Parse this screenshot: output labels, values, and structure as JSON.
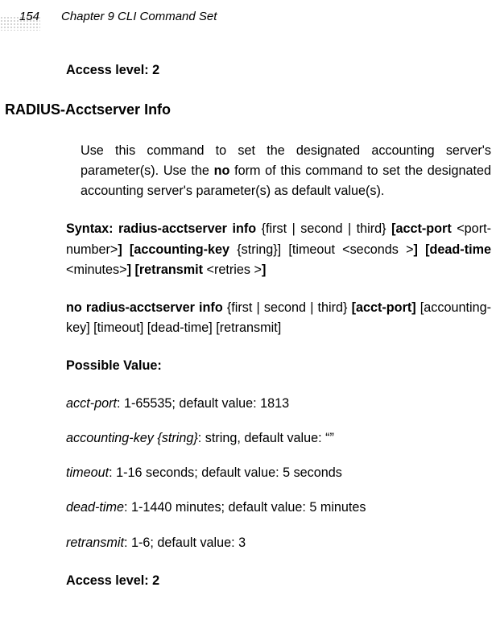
{
  "header": {
    "page_number": "154",
    "chapter": "Chapter 9 CLI Command Set"
  },
  "access_level_top": "Access level: 2",
  "section_heading": "RADIUS-Acctserver Info",
  "intro": {
    "t1": "Use this command to set the designated accounting server's parameter(s). Use the ",
    "bold_no": "no",
    "t2": " form of this command to set the designated accounting server's parameter(s) as default value(s)."
  },
  "syntax": {
    "lbl": "Syntax: radius-acctserver info",
    "p1": " {first | second | third} ",
    "b2": "[acct-port",
    "p2": " <port-number>",
    "b3": "]  [accounting-key",
    "p3": " {string}]  [timeout <seconds >",
    "b4": "] [dead-time",
    "p4": " <minutes>",
    "b5": "]  [retransmit",
    "p5": " <retries >",
    "b6": "]"
  },
  "no_form": {
    "b1": "no radius-acctserver info",
    "p1": " {first | second | third} ",
    "b2": "[acct-port]",
    "p2": " [accounting-key] [timeout] [dead-time] [retransmit]"
  },
  "possible_value_label": "Possible Value:",
  "pv": {
    "acct_port_i": "acct-port",
    "acct_port_t": ": 1-65535; default value: 1813",
    "acct_key_i": "accounting-key {string}",
    "acct_key_t": ": string, default value: “”",
    "timeout_i": "timeout",
    "timeout_t": ": 1-16 seconds; default value: 5 seconds",
    "dead_time_i": "dead-time",
    "dead_time_t": ": 1-1440 minutes; default value: 5 minutes",
    "retransmit_i": "retransmit",
    "retransmit_t": ": 1-6;  default value: 3"
  },
  "access_level_bottom": "Access level: 2"
}
